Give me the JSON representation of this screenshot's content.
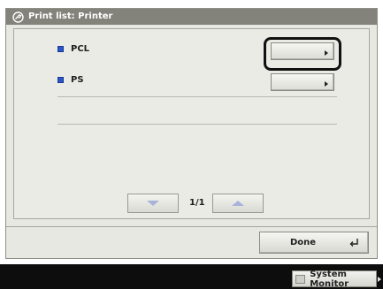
{
  "window": {
    "title": "Print list: Printer",
    "title_icon": "printer-wrench-icon"
  },
  "list": {
    "items": [
      {
        "label": "PCL",
        "selected": true
      },
      {
        "label": "PS",
        "selected": false
      }
    ]
  },
  "pager": {
    "indicator": "1/1",
    "prev_icon": "down-arrow-icon",
    "next_icon": "up-arrow-icon"
  },
  "footer": {
    "done_label": "Done",
    "done_icon": "enter-icon"
  },
  "statusbar": {
    "system_monitor_label": "System Monitor"
  },
  "colors": {
    "titlebar": "#83837b",
    "panel": "#e8e8e2",
    "bullet": "#2b56c6",
    "bottombar": "#0d0d0d"
  }
}
